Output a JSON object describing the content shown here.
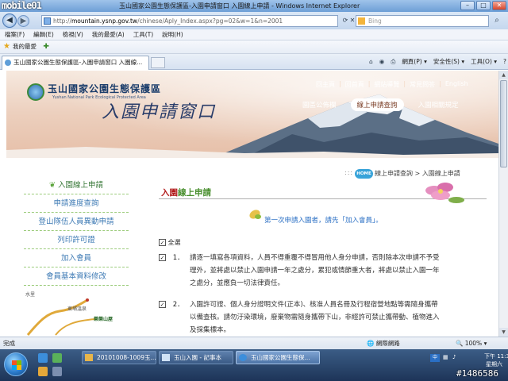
{
  "window": {
    "brand_logo": "mobile01",
    "title": "玉山國家公園生態保護區-入園申請窗口 入園線上申請 - Windows Internet Explorer",
    "buttons": {
      "minimize": "–",
      "maximize": "□",
      "close": "✕"
    }
  },
  "address_bar": {
    "url_prefix": "http://",
    "url_host": "mountain.ysnp.gov.tw",
    "url_path": "/chinese/Aply_Index.aspx?pg=02&w=1&n=2001",
    "search_placeholder": "Bing"
  },
  "menu": [
    "檔案(F)",
    "編輯(E)",
    "檢視(V)",
    "我的最愛(A)",
    "工具(T)",
    "說明(H)"
  ],
  "favorites": {
    "label": "我的最愛"
  },
  "tabs": [
    {
      "label": "玉山國家公園生態保護區-入園申請窗口 入園線..."
    }
  ],
  "command_bar": [
    "網頁(P) ▾",
    "安全性(S) ▾",
    "工具(O) ▾",
    "?"
  ],
  "site": {
    "name": "玉山國家公園生態保護區",
    "name_en": "Yushan National Park Ecological Protected Area",
    "slogan": "入園申請窗口",
    "top_links": [
      "回主頁",
      "回首頁",
      "網站導覽",
      "常見問答",
      "English"
    ],
    "main_nav": [
      {
        "label": "園區公佈欄",
        "active": false
      },
      {
        "label": "線上申請查詢",
        "active": true
      },
      {
        "label": "入園相關規定",
        "active": false
      }
    ],
    "breadcrumb": {
      "home": "HOME",
      "trail": "線上申請查詢 > 入園線上申請"
    }
  },
  "left_menu": [
    "入園線上申請",
    "申請進度查詢",
    "登山隊伍人員異動申請",
    "列印許可證",
    "加入會員",
    "會員基本資料修改"
  ],
  "left_map": {
    "labels": [
      "水里",
      "東埔溫泉",
      "樂樂山屋"
    ]
  },
  "content": {
    "title_prefix": "入園",
    "title_suffix": "線上申請",
    "register_notice": "第一次申請入園者，請先「加入會員」。",
    "agree_all": "全選",
    "terms": [
      {
        "num": "1．",
        "lines": [
          "請逐一填寫各項資料，人員不得重覆不得冒用他人身分申請，否則除本次申請不予受",
          "理外，並將處以禁止入園申請一年之處分，累犯或情節重大者，將處以禁止入園一年",
          "之處分，並應負一切法律責任。"
        ]
      },
      {
        "num": "2．",
        "lines": [
          "入園許可證、個人身分證明文件(正本)、核准人員名冊及行程宿營地點等需隨身攜帶",
          "以備查核。請勿汙染環境，廢棄物需隨身攜帶下山，非經許可禁止攜帶動、植物進入",
          "及採集標本。"
        ]
      }
    ]
  },
  "status_bar": {
    "status": "完成",
    "zone": "網際網路",
    "zoom": "100%"
  },
  "taskbar": {
    "buttons": [
      {
        "label": "20101008-1009玉...",
        "active": false
      },
      {
        "label": "玉山入園 - 記事本",
        "active": false
      },
      {
        "label": "玉山國家公園生態保...",
        "active": true
      }
    ],
    "clock_time": "下午 11:37",
    "clock_day": "星期六",
    "watermark": "#1486586"
  },
  "colors": {
    "accent_red": "#b21c1c",
    "accent_green": "#4a8f2f",
    "link_blue": "#3f7bb5"
  }
}
